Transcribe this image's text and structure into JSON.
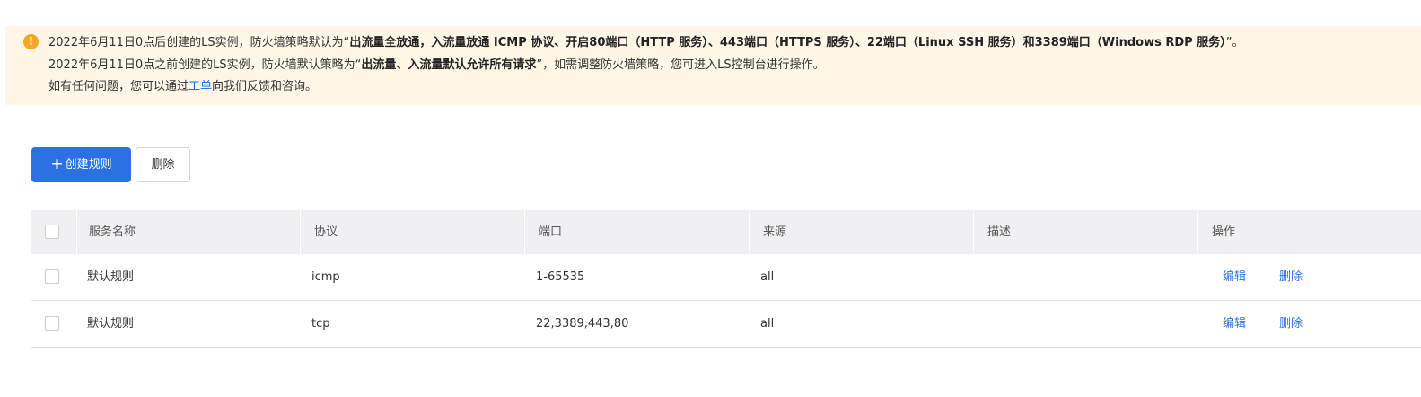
{
  "notice": {
    "icon": "warning-icon",
    "line1_prefix": "2022年6月11日0点后创建的LS实例，防火墙策略默认为“",
    "line1_bold": "出流量全放通，入流量放通 ICMP 协议、开启80端口（HTTP 服务）、443端口（HTTPS 服务）、22端口（Linux SSH 服务）和3389端口（Windows RDP 服务）",
    "line1_suffix": "”。",
    "line2_prefix": "2022年6月11日0点之前创建的LS实例，防火墙默认策略为“",
    "line2_bold": "出流量、入流量默认允许所有请求",
    "line2_suffix": "”，如需调整防火墙策略，您可进入LS控制台进行操作。",
    "line3_prefix": "如有任何问题，您可以通过",
    "line3_link": "工单",
    "line3_suffix": "向我们反馈和咨询。"
  },
  "toolbar": {
    "create_icon": "plus-icon",
    "create_label": "创建规则",
    "delete_label": "删除"
  },
  "table": {
    "columns": [
      "服务名称",
      "协议",
      "端口",
      "来源",
      "描述",
      "操作"
    ],
    "rows": [
      {
        "name": "默认规则",
        "protocol": "icmp",
        "port": "1-65535",
        "source": "all",
        "description": "",
        "edit": "编辑",
        "delete": "删除"
      },
      {
        "name": "默认规则",
        "protocol": "tcp",
        "port": "22,3389,443,80",
        "source": "all",
        "description": "",
        "edit": "编辑",
        "delete": "删除"
      }
    ]
  },
  "colors": {
    "primary": "#2b71e3",
    "notice_bg": "#fef6e6",
    "warning": "#f5a623",
    "table_header_bg": "#f0f0f2"
  }
}
